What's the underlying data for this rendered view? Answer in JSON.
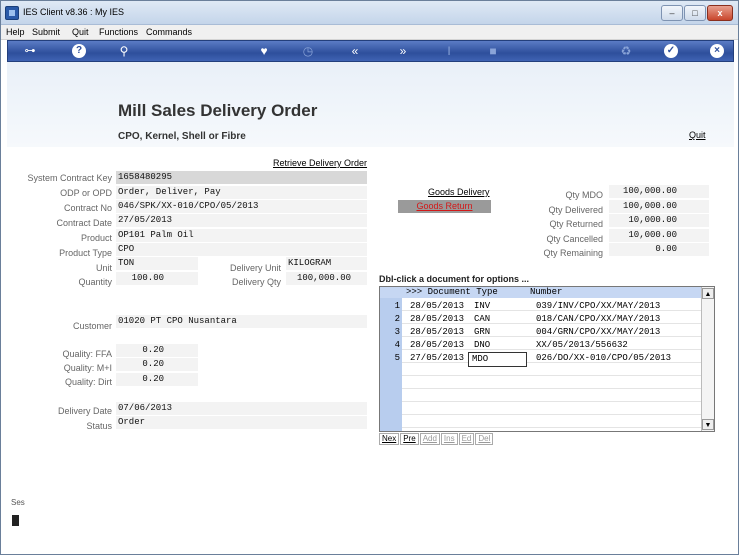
{
  "window": {
    "title": "IES Client v8.36 : My IES",
    "min_label": "–",
    "max_label": "□",
    "close_label": "x"
  },
  "menu": [
    "Help",
    "Submit",
    "Quit",
    "Functions",
    "Commands"
  ],
  "toolbar": {
    "icons": [
      "key-icon",
      "help-icon",
      "search-icon",
      "heart-icon",
      "clock-icon",
      "rewind-icon",
      "fast-forward-icon",
      "insert-cursor-icon",
      "stop-icon",
      "recycle-icon",
      "check-icon",
      "close-icon"
    ]
  },
  "header": {
    "title": "Mill Sales Delivery Order",
    "subtitle": "CPO, Kernel, Shell or Fibre",
    "quit_link": "Quit"
  },
  "form": {
    "retrieve_link": "Retrieve Delivery Order",
    "system_contract_key": {
      "label": "System Contract Key",
      "value": "1658480295"
    },
    "odp": {
      "label": "ODP or OPD",
      "value": "Order, Deliver, Pay"
    },
    "contract_no": {
      "label": "Contract No",
      "value": "046/SPK/XX-010/CPO/05/2013"
    },
    "contract_date": {
      "label": "Contract Date",
      "value": "27/05/2013"
    },
    "product": {
      "label": "Product",
      "value": "OP101 Palm Oil"
    },
    "product_type": {
      "label": "Product Type",
      "value": "CPO"
    },
    "unit": {
      "label": "Unit",
      "value": "TON"
    },
    "quantity": {
      "label": "Quantity",
      "value": "100.00"
    },
    "delivery_unit": {
      "label": "Delivery Unit",
      "value": "KILOGRAM"
    },
    "delivery_qty": {
      "label": "Delivery Qty",
      "value": "100,000.00"
    },
    "customer": {
      "label": "Customer",
      "value": "01020 PT CPO Nusantara"
    },
    "quality_ffa": {
      "label": "Quality: FFA",
      "value": "0.20"
    },
    "quality_mi": {
      "label": "Quality: M+I",
      "value": "0.20"
    },
    "quality_dirt": {
      "label": "Quality: Dirt",
      "value": "0.20"
    },
    "delivery_date": {
      "label": "Delivery Date",
      "value": "07/06/2013"
    },
    "status": {
      "label": "Status",
      "value": "Order"
    }
  },
  "actions": {
    "goods_delivery": "Goods Delivery",
    "goods_return": "Goods Return"
  },
  "quantities": {
    "qty_mdo": {
      "label": "Qty MDO",
      "value": "100,000.00"
    },
    "qty_delivered": {
      "label": "Qty Delivered",
      "value": "100,000.00"
    },
    "qty_returned": {
      "label": "Qty Returned",
      "value": "10,000.00"
    },
    "qty_cancelled": {
      "label": "Qty Cancelled",
      "value": "10,000.00"
    },
    "qty_remaining": {
      "label": "Qty Remaining",
      "value": "0.00"
    }
  },
  "documents": {
    "heading": "Dbl-click a document for options ...",
    "columns": [
      ">>> Document Type",
      "Number"
    ],
    "rows": [
      {
        "n": "1",
        "date": "28/05/2013",
        "type": "INV",
        "number": "039/INV/CPO/XX/MAY/2013"
      },
      {
        "n": "2",
        "date": "28/05/2013",
        "type": "CAN",
        "number": "018/CAN/CPO/XX/MAY/2013"
      },
      {
        "n": "3",
        "date": "28/05/2013",
        "type": "GRN",
        "number": "004/GRN/CPO/XX/MAY/2013"
      },
      {
        "n": "4",
        "date": "28/05/2013",
        "type": "DNO",
        "number": "XX/05/2013/556632"
      },
      {
        "n": "5",
        "date": "27/05/2013",
        "type": "MDO",
        "number": "026/DO/XX-010/CPO/05/2013"
      }
    ],
    "buttons": [
      "Nex",
      "Pre",
      "Add",
      "Ins",
      "Ed",
      "Del"
    ]
  },
  "session_label": "Ses"
}
